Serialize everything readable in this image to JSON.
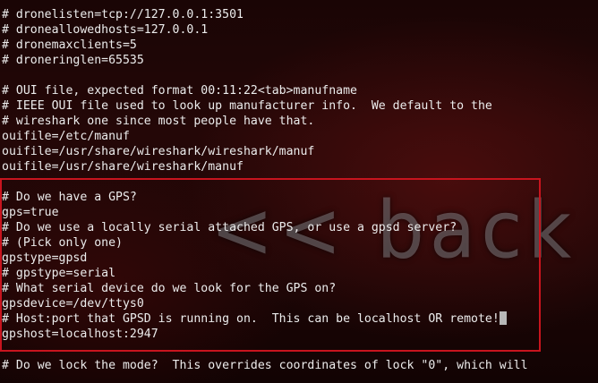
{
  "watermark": "<< back | t",
  "lines": [
    "# dronelisten=tcp://127.0.0.1:3501",
    "# droneallowedhosts=127.0.0.1",
    "# dronemaxclients=5",
    "# droneringlen=65535",
    "",
    "# OUI file, expected format 00:11:22<tab>manufname",
    "# IEEE OUI file used to look up manufacturer info.  We default to the",
    "# wireshark one since most people have that.",
    "ouifile=/etc/manuf",
    "ouifile=/usr/share/wireshark/wireshark/manuf",
    "ouifile=/usr/share/wireshark/manuf",
    "",
    "# Do we have a GPS?",
    "gps=true",
    "# Do we use a locally serial attached GPS, or use a gpsd server?",
    "# (Pick only one)",
    "gpstype=gpsd",
    "# gpstype=serial",
    "# What serial device do we look for the GPS on?",
    "gpsdevice=/dev/ttys0",
    "# Host:port that GPSD is running on.  This can be localhost OR remote!",
    "gpshost=localhost:2947",
    "",
    "# Do we lock the mode?  This overrides coordinates of lock \"0\", which will"
  ],
  "cursor_line_index": 20
}
